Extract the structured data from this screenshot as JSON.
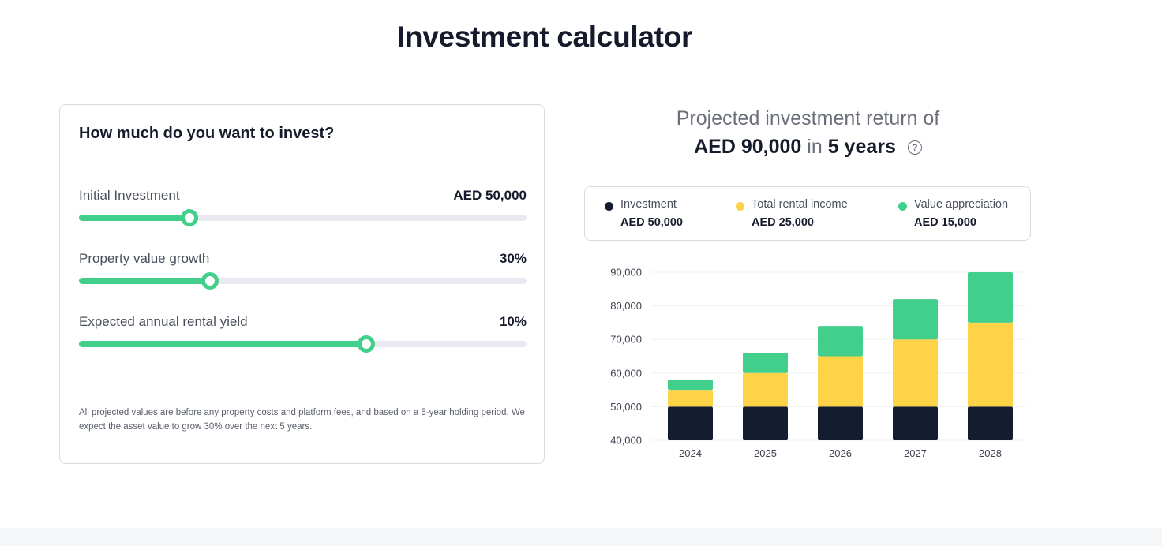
{
  "page": {
    "title": "Investment calculator"
  },
  "calculator": {
    "heading": "How much do you want to invest?",
    "sliders": [
      {
        "label": "Initial Investment",
        "value_text": "AED 50,000",
        "fraction": 0.247
      },
      {
        "label": "Property value growth",
        "value_text": "30%",
        "fraction": 0.293
      },
      {
        "label": "Expected annual rental yield",
        "value_text": "10%",
        "fraction": 0.642
      }
    ],
    "disclaimer": "All projected values are before any property costs and platform fees, and based on a 5-year holding period. We expect the asset value to grow 30% over the next 5 years."
  },
  "projection": {
    "line1": "Projected investment return of",
    "amount": "AED 90,000",
    "in_word": "in",
    "period": "5 years",
    "help_icon": "question-circle-icon",
    "help_glyph": "?"
  },
  "legend": [
    {
      "name": "Investment",
      "amount": "AED 50,000",
      "color": "#141d30"
    },
    {
      "name": "Total rental income",
      "amount": "AED 25,000",
      "color": "#ffd347"
    },
    {
      "name": "Value appreciation",
      "amount": "AED 15,000",
      "color": "#42cf8c"
    }
  ],
  "colors": {
    "accent_green": "#42cf8c",
    "navy": "#141d30",
    "yellow": "#ffd347"
  },
  "chart_data": {
    "type": "bar",
    "stacked": true,
    "categories": [
      "2024",
      "2025",
      "2026",
      "2027",
      "2028"
    ],
    "series": [
      {
        "name": "Investment",
        "color": "#141d30",
        "values": [
          50000,
          50000,
          50000,
          50000,
          50000
        ]
      },
      {
        "name": "Total rental income",
        "color": "#ffd347",
        "values": [
          5000,
          10000,
          15000,
          20000,
          25000
        ]
      },
      {
        "name": "Value appreciation",
        "color": "#42cf8c",
        "values": [
          3000,
          6000,
          9000,
          12000,
          15000
        ]
      }
    ],
    "yticks": [
      "40,000",
      "50,000",
      "60,000",
      "70,000",
      "80,000",
      "90,000"
    ],
    "ylim": [
      40000,
      90000
    ],
    "grid": true,
    "xlabel": "",
    "ylabel": ""
  }
}
